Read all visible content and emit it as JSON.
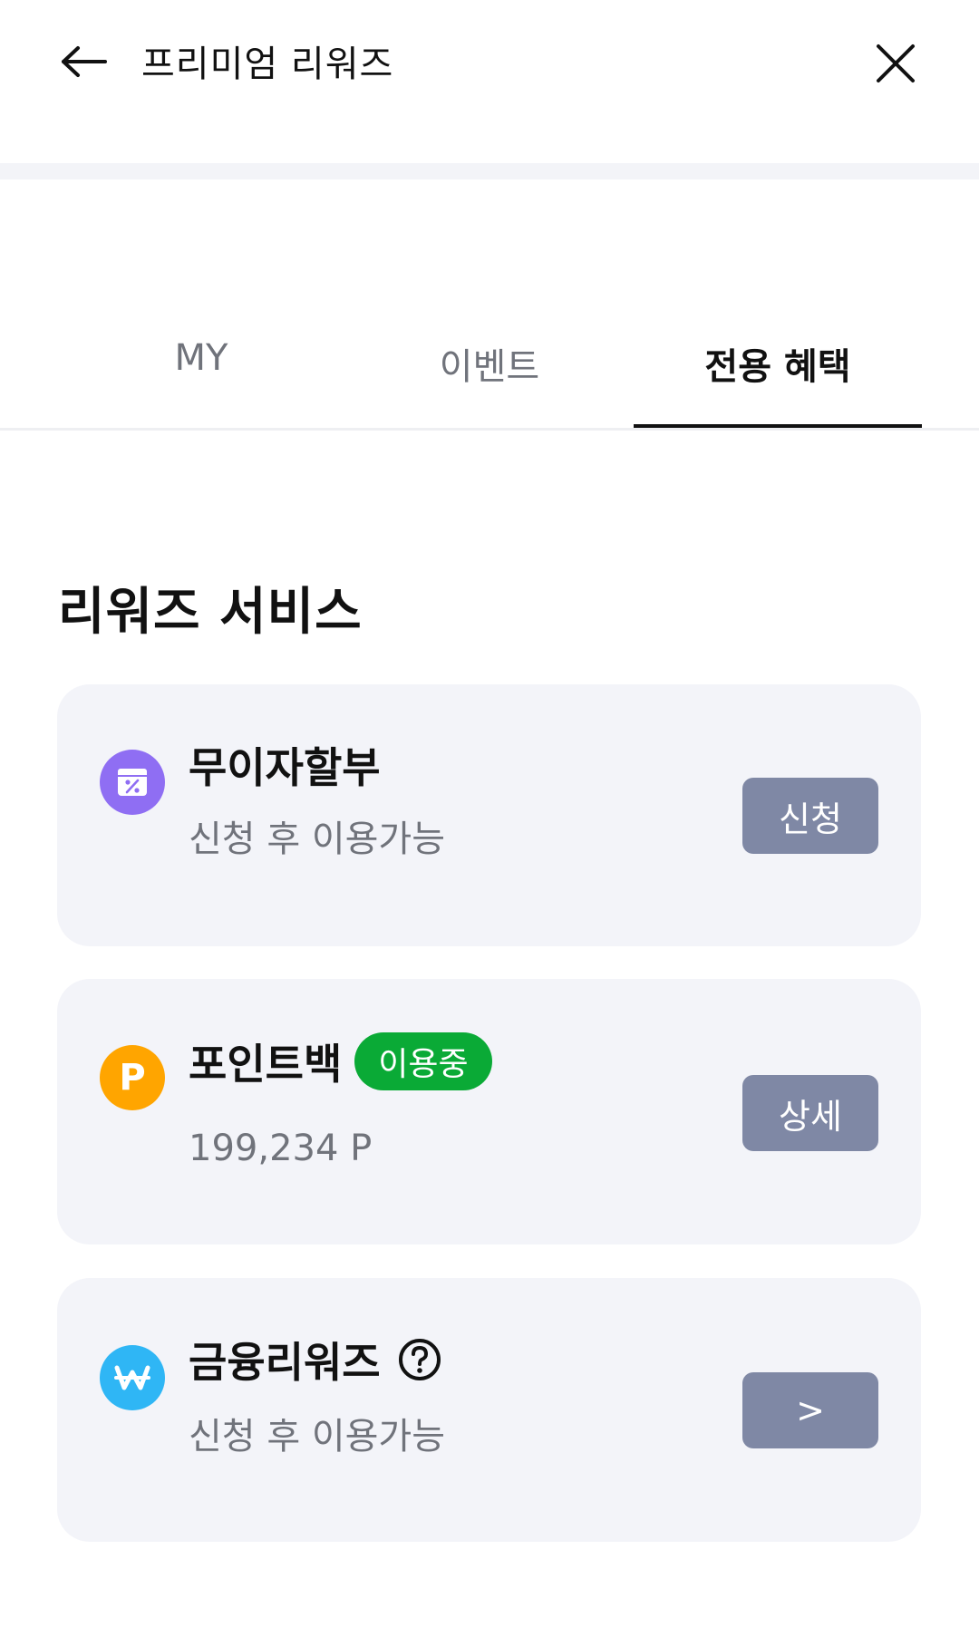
{
  "header": {
    "title": "프리미엄 리워즈",
    "back_icon": "arrow-left-icon",
    "close_icon": "close-icon"
  },
  "tabs": [
    {
      "label": "MY",
      "active": false
    },
    {
      "label": "이벤트",
      "active": false
    },
    {
      "label": "전용 혜택",
      "active": true
    }
  ],
  "section": {
    "title": "리워즈 서비스"
  },
  "services": [
    {
      "icon": "calendar-percent-icon",
      "icon_color": "#8f6ef3",
      "title": "무이자할부",
      "subtitle": "신청 후 이용가능",
      "button_label": "신청"
    },
    {
      "icon": "point-p-icon",
      "icon_color": "#ffa500",
      "icon_text": "P",
      "title": "포인트백",
      "badge": "이용중",
      "subtitle": "199,234 P",
      "button_label": "상세"
    },
    {
      "icon": "won-icon",
      "icon_color": "#2fb6f5",
      "title": "금융리워즈",
      "help_icon": "question-circle-icon",
      "subtitle": "신청 후 이용가능",
      "button_label": ">"
    }
  ],
  "colors": {
    "card_bg": "#f3f4f9",
    "button_bg": "#7f88a5",
    "badge_bg": "#0aaa36"
  }
}
